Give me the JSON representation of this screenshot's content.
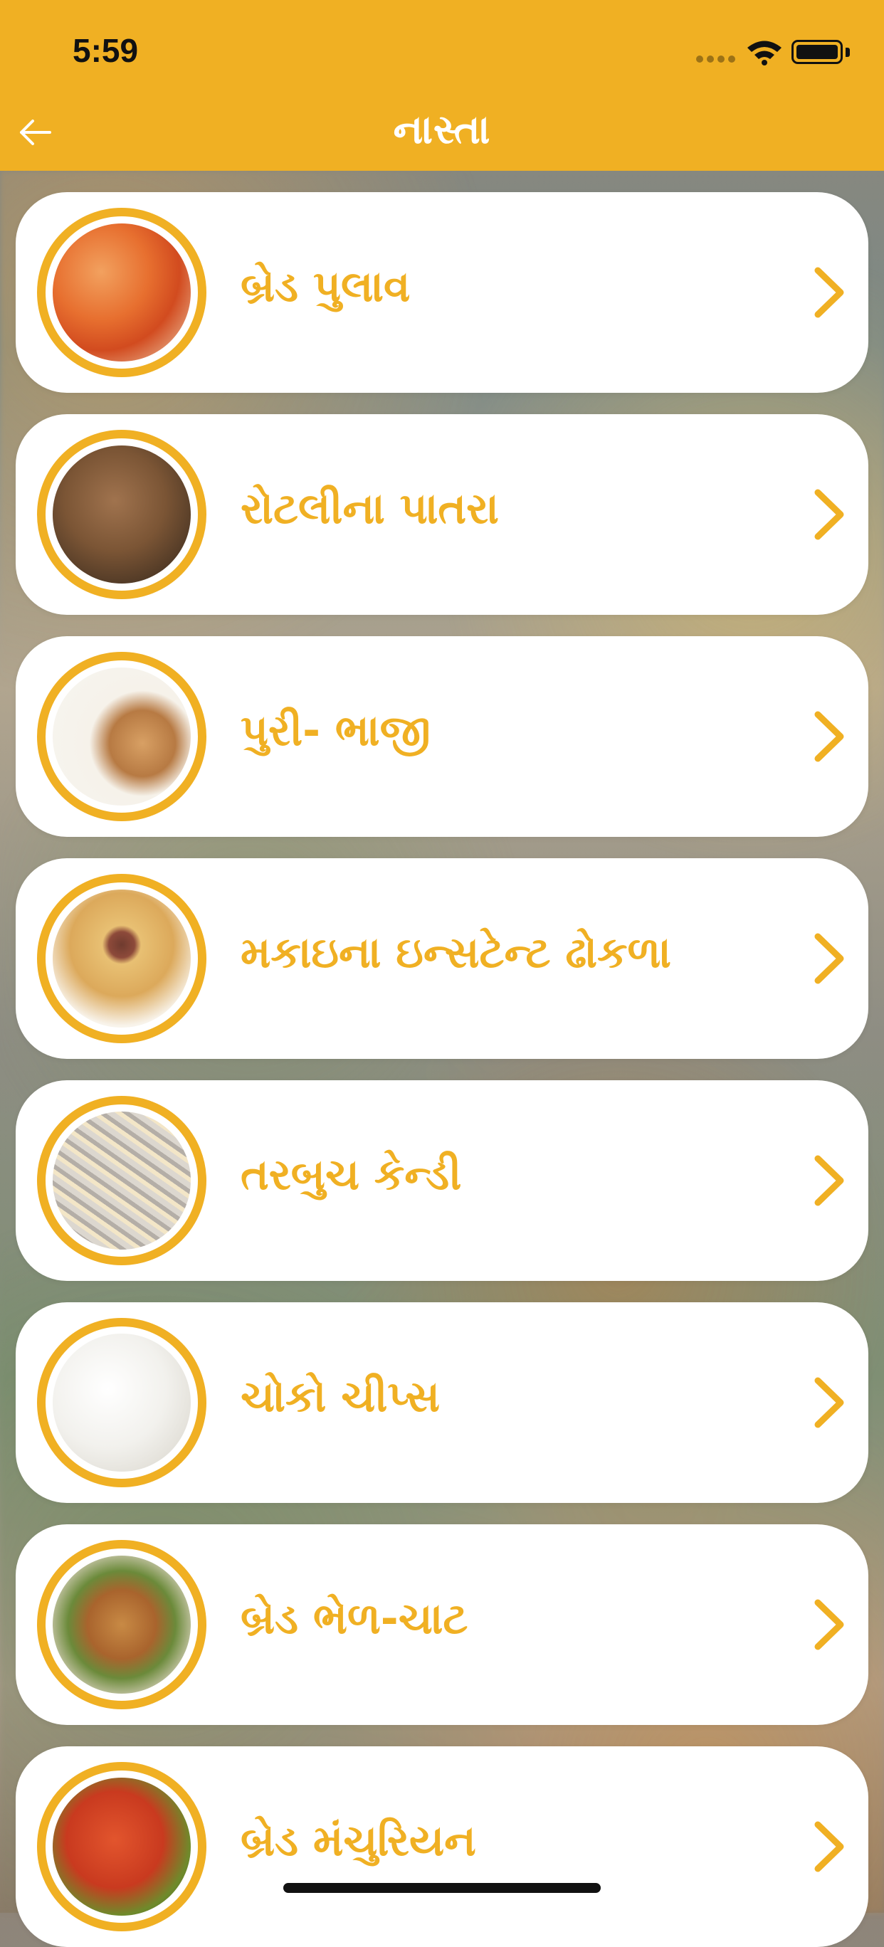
{
  "status_bar": {
    "time": "5:59",
    "icons": [
      "signal-dots-icon",
      "wifi-icon",
      "battery-icon"
    ]
  },
  "header": {
    "title": "નાસ્તા",
    "back_icon": "back-arrow-icon",
    "accent_color": "#f0b023"
  },
  "items": [
    {
      "label": "બ્રેડ પુલાવ",
      "thumb": "bread-pulao"
    },
    {
      "label": "રોટલીના પાતરા",
      "thumb": "rotli-patra"
    },
    {
      "label": "પુરી- ભાજી",
      "thumb": "puri-bhaji"
    },
    {
      "label": "મકાઇના ઇન્સટેન્ટ ઢોકળા",
      "thumb": "instant-dhokla"
    },
    {
      "label": "તરબુચ કેન્ડી",
      "thumb": "watermelon-candy"
    },
    {
      "label": "ચોકો ચીપ્સ",
      "thumb": "choco-chips"
    },
    {
      "label": "બ્રેડ ભેળ-ચાટ",
      "thumb": "bread-bhel-chaat"
    },
    {
      "label": "બ્રેડ મંચુરિયન",
      "thumb": "bread-manchurian"
    }
  ]
}
